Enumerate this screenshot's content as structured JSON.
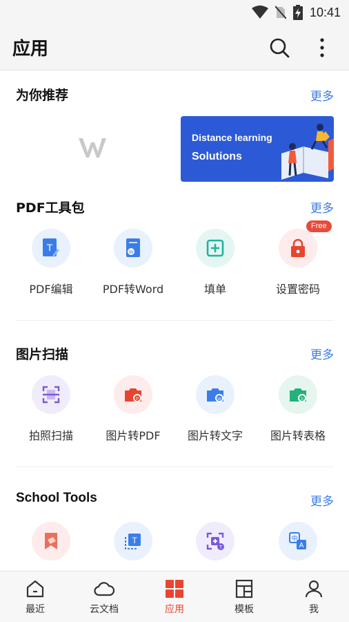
{
  "status_bar": {
    "time": "10:41",
    "icons": [
      "wifi-icon",
      "no-sim-icon",
      "battery-charging-icon"
    ]
  },
  "app_bar": {
    "title": "应用",
    "icons": [
      "search-icon",
      "more-vertical-icon"
    ]
  },
  "recommend": {
    "title": "为你推荐",
    "more": "更多",
    "banner": {
      "line1": "Distance learning",
      "line2": "Solutions"
    },
    "colors": {
      "banner_bg": "#2c5ad6"
    }
  },
  "pdf_tools": {
    "title": "PDF工具包",
    "more": "更多",
    "items": [
      {
        "label": "PDF编辑",
        "icon": "pdf-edit-icon"
      },
      {
        "label": "PDF转Word",
        "icon": "pdf-to-word-icon"
      },
      {
        "label": "填单",
        "icon": "fill-form-icon"
      },
      {
        "label": "设置密码",
        "icon": "lock-icon",
        "badge": "Free"
      }
    ]
  },
  "image_scan": {
    "title": "图片扫描",
    "more": "更多",
    "items": [
      {
        "label": "拍照扫描",
        "icon": "scan-icon"
      },
      {
        "label": "图片转PDF",
        "icon": "image-to-pdf-icon"
      },
      {
        "label": "图片转文字",
        "icon": "image-to-text-icon"
      },
      {
        "label": "图片转表格",
        "icon": "image-to-table-icon"
      }
    ]
  },
  "school_tools": {
    "title": "School Tools",
    "more": "更多",
    "items": [
      {
        "icon": "bookmark-hand-icon"
      },
      {
        "icon": "text-recognize-icon"
      },
      {
        "icon": "photo-translate-icon"
      },
      {
        "icon": "translate-icon"
      }
    ]
  },
  "bottom_nav": {
    "items": [
      {
        "label": "最近",
        "icon": "home-icon"
      },
      {
        "label": "云文档",
        "icon": "cloud-icon"
      },
      {
        "label": "应用",
        "icon": "apps-grid-icon",
        "active": true
      },
      {
        "label": "模板",
        "icon": "template-icon"
      },
      {
        "label": "我",
        "icon": "user-icon"
      }
    ],
    "active_color": "#e8452f"
  }
}
